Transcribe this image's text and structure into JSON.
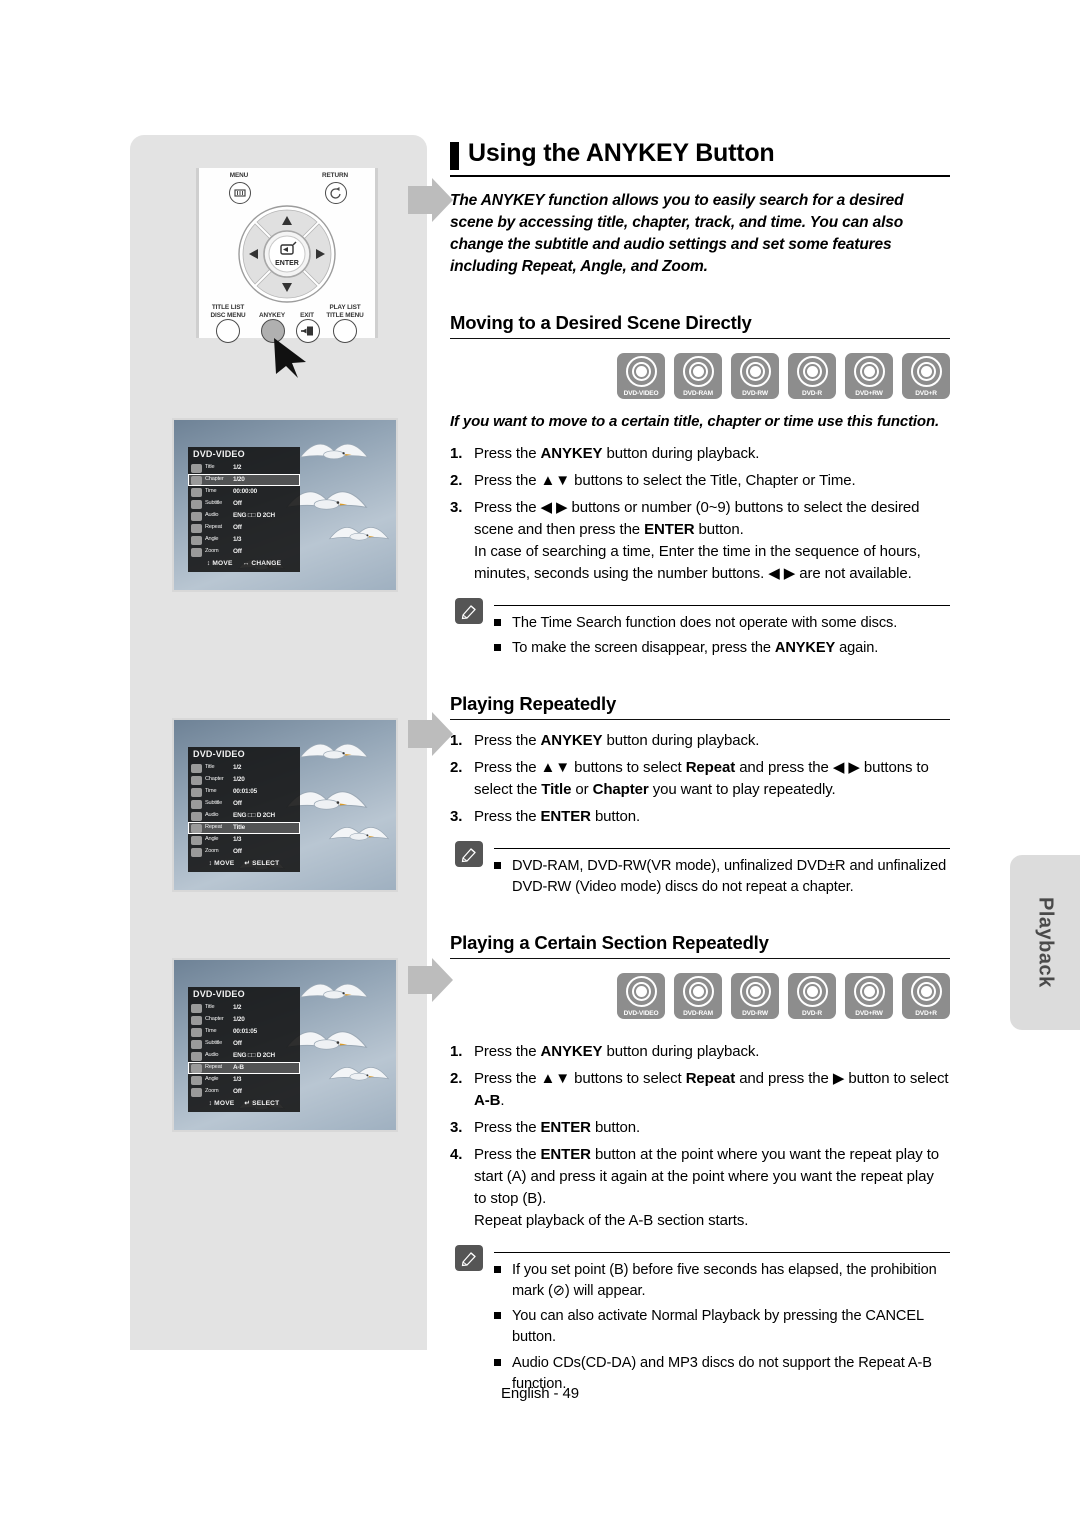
{
  "page": {
    "footer": "English - 49",
    "side_tab": "Playback"
  },
  "header": {
    "title": "Using the ANYKEY Button",
    "intro": "The ANYKEY function allows you to easily search for a desired scene by accessing title, chapter, track, and time. You can also change the subtitle and audio settings and set some features including Repeat, Angle, and Zoom."
  },
  "remote": {
    "menu_label": "MENU",
    "return_label": "RETURN",
    "enter_label": "ENTER",
    "title_list_label": "TITLE LIST",
    "disc_menu_label": "DISC MENU",
    "anykey_label": "ANYKEY",
    "exit_label": "EXIT",
    "play_list_label": "PLAY LIST",
    "title_menu_label": "TITLE MENU"
  },
  "disc_icons": [
    "DVD-VIDEO",
    "DVD-RAM",
    "DVD-RW",
    "DVD-R",
    "DVD+RW",
    "DVD+R"
  ],
  "sections": [
    {
      "heading": "Moving to a Desired Scene Directly",
      "emphasis": "If you want to move to a certain title, chapter or time use this function.",
      "steps": [
        "Press the <b>ANYKEY</b> button during playback.",
        "Press the ▲▼ buttons to select the Title, Chapter or Time.",
        "Press the ◀ ▶ buttons or number (0~9) buttons to select the desired scene and then press the <b>ENTER</b> button.<br>In case of searching a time, Enter the time in the sequence of hours, minutes, seconds using the number buttons. ◀ ▶ are not available."
      ],
      "notes": [
        "The Time Search function does not operate with some discs.",
        "To make the screen disappear, press the <b>ANYKEY</b> again."
      ]
    },
    {
      "heading": "Playing Repeatedly",
      "emphasis": "",
      "steps": [
        "Press the <b>ANYKEY</b> button during playback.",
        "Press the ▲▼ buttons to select <b>Repeat</b> and press the ◀ ▶ buttons to select the <b>Title</b> or <b>Chapter</b> you want to play repeatedly.",
        "Press the <b>ENTER</b> button."
      ],
      "notes": [
        "DVD-RAM, DVD-RW(VR mode), unfinalized DVD±R and unfinalized DVD-RW (Video mode) discs do not repeat a chapter."
      ]
    },
    {
      "heading": "Playing a Certain Section Repeatedly",
      "emphasis": "",
      "steps": [
        "Press the <b>ANYKEY</b> button during playback.",
        "Press the ▲▼ buttons to select <b>Repeat</b> and press the ▶ button to select <b>A-B</b>.",
        "Press the <b>ENTER</b> button.",
        "Press the <b>ENTER</b> button at the point where you want the repeat play to start (A) and press it again at the point where you want the repeat play to stop (B).<br>Repeat playback of the A-B section starts."
      ],
      "notes": [
        "If you set point (B) before five seconds has elapsed, the prohibition mark (⊘) will appear.",
        "You can also activate Normal Playback by pressing the CANCEL button.",
        "Audio CDs(CD-DA) and MP3 discs do not support the Repeat A-B function."
      ]
    }
  ],
  "osd_screens": [
    {
      "title": "DVD-VIDEO",
      "rows": [
        {
          "key": "Title",
          "value": "1/2",
          "selected": false
        },
        {
          "key": "Chapter",
          "value": "1/20",
          "selected": true
        },
        {
          "key": "Time",
          "value": "00:00:00",
          "selected": false
        },
        {
          "key": "Subtitle",
          "value": "Off",
          "selected": false
        },
        {
          "key": "Audio",
          "value": "ENG □□ D 2CH",
          "selected": false
        },
        {
          "key": "Repeat",
          "value": "Off",
          "selected": false
        },
        {
          "key": "Angle",
          "value": "1/3",
          "selected": false
        },
        {
          "key": "Zoom",
          "value": "Off",
          "selected": false
        }
      ],
      "foot_move": "MOVE",
      "foot_action": "CHANGE"
    },
    {
      "title": "DVD-VIDEO",
      "rows": [
        {
          "key": "Title",
          "value": "1/2",
          "selected": false
        },
        {
          "key": "Chapter",
          "value": "1/20",
          "selected": false
        },
        {
          "key": "Time",
          "value": "00:01:05",
          "selected": false
        },
        {
          "key": "Subtitle",
          "value": "Off",
          "selected": false
        },
        {
          "key": "Audio",
          "value": "ENG □□ D 2CH",
          "selected": false
        },
        {
          "key": "Repeat",
          "value": "Title",
          "selected": true
        },
        {
          "key": "Angle",
          "value": "1/3",
          "selected": false
        },
        {
          "key": "Zoom",
          "value": "Off",
          "selected": false
        }
      ],
      "foot_move": "MOVE",
      "foot_action": "SELECT"
    },
    {
      "title": "DVD-VIDEO",
      "rows": [
        {
          "key": "Title",
          "value": "1/2",
          "selected": false
        },
        {
          "key": "Chapter",
          "value": "1/20",
          "selected": false
        },
        {
          "key": "Time",
          "value": "00:01:05",
          "selected": false
        },
        {
          "key": "Subtitle",
          "value": "Off",
          "selected": false
        },
        {
          "key": "Audio",
          "value": "ENG □□ D 2CH",
          "selected": false
        },
        {
          "key": "Repeat",
          "value": "A-B",
          "selected": true
        },
        {
          "key": "Angle",
          "value": "1/3",
          "selected": false
        },
        {
          "key": "Zoom",
          "value": "Off",
          "selected": false
        }
      ],
      "foot_move": "MOVE",
      "foot_action": "SELECT"
    }
  ]
}
